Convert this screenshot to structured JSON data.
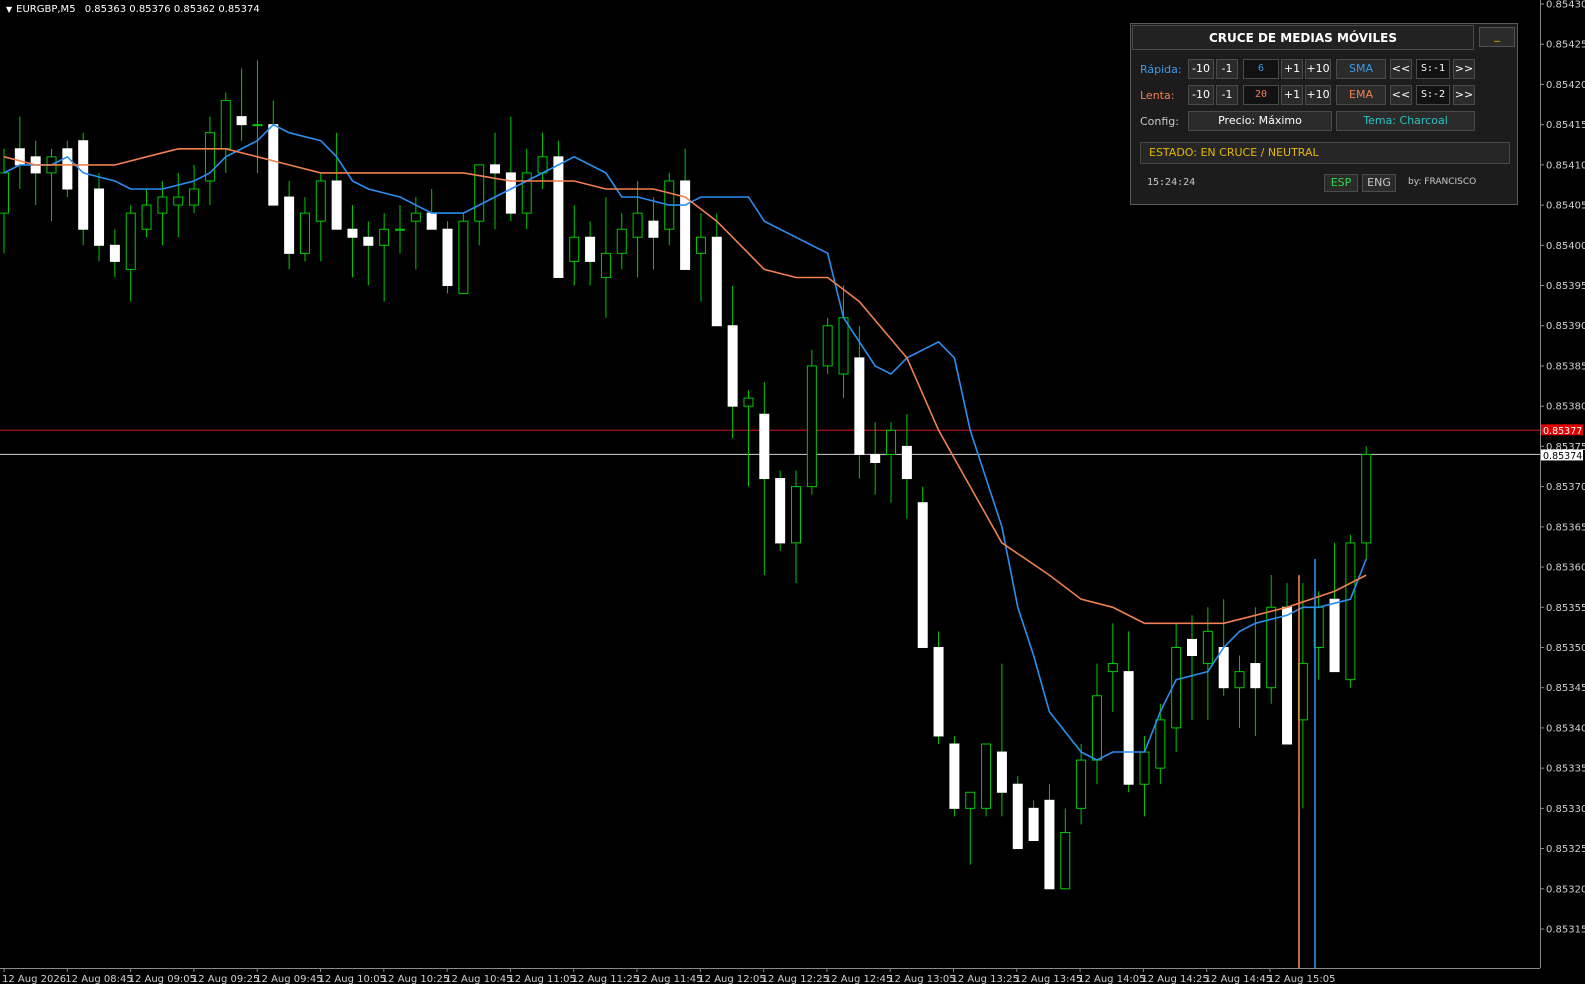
{
  "chart_header": {
    "symbol": "EURGBP,M5",
    "ohlc": "0.85363 0.85376 0.85362 0.85374"
  },
  "colors": {
    "bull_wick": "#00c800",
    "bear_body": "#ffffff",
    "fast_ma": "#2b8ff0",
    "slow_ma": "#f08050",
    "bid_line": "#cfcfcf",
    "ask_line": "#d21a1a",
    "ask_tag": "#e00000"
  },
  "price_axis": {
    "labels": [
      "0.85430",
      "0.85425",
      "0.85420",
      "0.85415",
      "0.85410",
      "0.85405",
      "0.85400",
      "0.85395",
      "0.85390",
      "0.85385",
      "0.85380",
      "0.85375",
      "0.85370",
      "0.85365",
      "0.85360",
      "0.85355",
      "0.85350",
      "0.85345",
      "0.85340",
      "0.85335",
      "0.85330",
      "0.85325",
      "0.85320",
      "0.85315"
    ],
    "ask_tag": "0.85377",
    "bid_tag": "0.85374"
  },
  "time_axis": {
    "labels": [
      "12 Aug 2026",
      "12 Aug 08:45",
      "12 Aug 09:05",
      "12 Aug 09:25",
      "12 Aug 09:45",
      "12 Aug 10:05",
      "12 Aug 10:25",
      "12 Aug 10:45",
      "12 Aug 11:05",
      "12 Aug 11:25",
      "12 Aug 11:45",
      "12 Aug 12:05",
      "12 Aug 12:25",
      "12 Aug 12:45",
      "12 Aug 13:05",
      "12 Aug 13:25",
      "12 Aug 13:45",
      "12 Aug 14:05",
      "12 Aug 14:25",
      "12 Aug 14:45",
      "12 Aug 15:05"
    ]
  },
  "panel": {
    "title": "CRUCE DE MEDIAS MÓVILES",
    "minimize": "_",
    "fast": {
      "label": "Rápida:",
      "m10": "-10",
      "m1": "-1",
      "value": "6",
      "p1": "+1",
      "p10": "+10",
      "type": "SMA",
      "prev": "<<",
      "shift": "S:-1",
      "next": ">>"
    },
    "slow": {
      "label": "Lenta:",
      "m10": "-10",
      "m1": "-1",
      "value": "20",
      "p1": "+1",
      "p10": "+10",
      "type": "EMA",
      "prev": "<<",
      "shift": "S:-2",
      "next": ">>"
    },
    "config": {
      "label": "Config:",
      "price": "Precio: Máximo",
      "theme": "Tema: Charcoal"
    },
    "status": "ESTADO: EN CRUCE / NEUTRAL",
    "clock": "15:24:24",
    "lang_esp": "ESP",
    "lang_eng": "ENG",
    "author": "by: FRANCISCO"
  },
  "chart_data": {
    "type": "candlestick",
    "symbol": "EURGBP",
    "timeframe": "M5",
    "ylim": [
      0.8531,
      0.8543
    ],
    "candles": [
      [
        0.85404,
        0.85412,
        0.85399,
        0.85409
      ],
      [
        0.85412,
        0.85416,
        0.85407,
        0.8541
      ],
      [
        0.85411,
        0.85413,
        0.85405,
        0.85409
      ],
      [
        0.85409,
        0.85412,
        0.85403,
        0.85411
      ],
      [
        0.85412,
        0.85413,
        0.85406,
        0.85407
      ],
      [
        0.85413,
        0.85414,
        0.854,
        0.85402
      ],
      [
        0.85407,
        0.85409,
        0.85398,
        0.854
      ],
      [
        0.854,
        0.85402,
        0.85396,
        0.85398
      ],
      [
        0.85397,
        0.85405,
        0.85393,
        0.85404
      ],
      [
        0.85402,
        0.85407,
        0.85401,
        0.85405
      ],
      [
        0.85404,
        0.85408,
        0.854,
        0.85406
      ],
      [
        0.85405,
        0.85409,
        0.85401,
        0.85406
      ],
      [
        0.85405,
        0.8541,
        0.85404,
        0.85407
      ],
      [
        0.85408,
        0.85416,
        0.85405,
        0.85414
      ],
      [
        0.85412,
        0.85419,
        0.85409,
        0.85418
      ],
      [
        0.85416,
        0.85422,
        0.85413,
        0.85415
      ],
      [
        0.85415,
        0.85423,
        0.85409,
        0.85415
      ],
      [
        0.85415,
        0.85418,
        0.85407,
        0.85405
      ],
      [
        0.85406,
        0.85408,
        0.85397,
        0.85399
      ],
      [
        0.85399,
        0.85406,
        0.85398,
        0.85404
      ],
      [
        0.85403,
        0.85409,
        0.85398,
        0.85408
      ],
      [
        0.85408,
        0.85414,
        0.85402,
        0.85402
      ],
      [
        0.85402,
        0.85405,
        0.85396,
        0.85401
      ],
      [
        0.85401,
        0.85403,
        0.85395,
        0.854
      ],
      [
        0.854,
        0.85404,
        0.85393,
        0.85402
      ],
      [
        0.85402,
        0.85405,
        0.85399,
        0.85402
      ],
      [
        0.85403,
        0.85406,
        0.85397,
        0.85404
      ],
      [
        0.85404,
        0.85407,
        0.85403,
        0.85402
      ],
      [
        0.85402,
        0.85403,
        0.85394,
        0.85395
      ],
      [
        0.85394,
        0.85404,
        0.85394,
        0.85403
      ],
      [
        0.85403,
        0.85409,
        0.854,
        0.8541
      ],
      [
        0.8541,
        0.85414,
        0.85402,
        0.85409
      ],
      [
        0.85409,
        0.85416,
        0.85403,
        0.85404
      ],
      [
        0.85404,
        0.85412,
        0.85402,
        0.85409
      ],
      [
        0.85409,
        0.85414,
        0.85407,
        0.85411
      ],
      [
        0.85411,
        0.85413,
        0.85399,
        0.85396
      ],
      [
        0.85398,
        0.85405,
        0.85395,
        0.85401
      ],
      [
        0.85401,
        0.85403,
        0.85395,
        0.85398
      ],
      [
        0.85396,
        0.85406,
        0.85391,
        0.85399
      ],
      [
        0.85399,
        0.85404,
        0.85397,
        0.85402
      ],
      [
        0.85401,
        0.85408,
        0.85396,
        0.85404
      ],
      [
        0.85403,
        0.85406,
        0.85397,
        0.85401
      ],
      [
        0.85402,
        0.85409,
        0.854,
        0.85408
      ],
      [
        0.85408,
        0.85412,
        0.854,
        0.85397
      ],
      [
        0.85399,
        0.85404,
        0.85393,
        0.85401
      ],
      [
        0.85401,
        0.85404,
        0.8539,
        0.8539
      ],
      [
        0.8539,
        0.85395,
        0.85376,
        0.8538
      ],
      [
        0.8538,
        0.85382,
        0.8537,
        0.85381
      ],
      [
        0.85379,
        0.85383,
        0.85359,
        0.85371
      ],
      [
        0.85371,
        0.85372,
        0.85362,
        0.85363
      ],
      [
        0.85363,
        0.85372,
        0.85358,
        0.8537
      ],
      [
        0.8537,
        0.85387,
        0.85369,
        0.85385
      ],
      [
        0.85385,
        0.85391,
        0.85384,
        0.8539
      ],
      [
        0.85384,
        0.85395,
        0.85381,
        0.85391
      ],
      [
        0.85386,
        0.8539,
        0.85371,
        0.85374
      ],
      [
        0.85374,
        0.85378,
        0.85369,
        0.85373
      ],
      [
        0.85374,
        0.85378,
        0.85368,
        0.85377
      ],
      [
        0.85375,
        0.85379,
        0.85366,
        0.85371
      ],
      [
        0.85368,
        0.8537,
        0.8535,
        0.8535
      ],
      [
        0.8535,
        0.85352,
        0.85338,
        0.85339
      ],
      [
        0.85338,
        0.85339,
        0.85329,
        0.8533
      ],
      [
        0.8533,
        0.85332,
        0.85323,
        0.85332
      ],
      [
        0.8533,
        0.85338,
        0.85329,
        0.85338
      ],
      [
        0.85337,
        0.85348,
        0.85329,
        0.85332
      ],
      [
        0.85333,
        0.85334,
        0.85325,
        0.85325
      ],
      [
        0.8533,
        0.85331,
        0.85326,
        0.85326
      ],
      [
        0.85331,
        0.85333,
        0.8532,
        0.8532
      ],
      [
        0.8532,
        0.8533,
        0.8532,
        0.85327
      ],
      [
        0.8533,
        0.85338,
        0.85328,
        0.85336
      ],
      [
        0.85336,
        0.85348,
        0.85333,
        0.85344
      ],
      [
        0.85347,
        0.85353,
        0.85342,
        0.85348
      ],
      [
        0.85347,
        0.85352,
        0.85332,
        0.85333
      ],
      [
        0.85333,
        0.85339,
        0.85329,
        0.85337
      ],
      [
        0.85335,
        0.85343,
        0.85333,
        0.85341
      ],
      [
        0.8534,
        0.85353,
        0.85337,
        0.8535
      ],
      [
        0.85351,
        0.85354,
        0.85341,
        0.85349
      ],
      [
        0.85348,
        0.85355,
        0.85341,
        0.85352
      ],
      [
        0.8535,
        0.85356,
        0.85344,
        0.85345
      ],
      [
        0.85345,
        0.85349,
        0.8534,
        0.85347
      ],
      [
        0.85348,
        0.85355,
        0.85339,
        0.85345
      ],
      [
        0.85345,
        0.85359,
        0.85343,
        0.85355
      ],
      [
        0.85355,
        0.85358,
        0.85345,
        0.85338
      ],
      [
        0.85341,
        0.85358,
        0.8533,
        0.85348
      ],
      [
        0.8535,
        0.85357,
        0.85346,
        0.85355
      ],
      [
        0.85356,
        0.85363,
        0.85348,
        0.85347
      ],
      [
        0.85346,
        0.85364,
        0.85345,
        0.85363
      ],
      [
        0.85363,
        0.85375,
        0.85361,
        0.85374
      ]
    ],
    "fast_ma": [
      0.85409,
      0.8541,
      0.8541,
      0.85411,
      0.85409,
      0.85408,
      0.85407,
      0.85407,
      0.85407,
      0.85408,
      0.85409,
      0.85411,
      0.85413,
      0.85415,
      0.85414,
      0.85413,
      0.85411,
      0.85408,
      0.85407,
      0.85406,
      0.85405,
      0.85404,
      0.85404,
      0.85405,
      0.85406,
      0.85408,
      0.85409,
      0.8541,
      0.85411,
      0.85409,
      0.85406,
      0.85406,
      0.85405,
      0.85405,
      0.85406,
      0.85406,
      0.85406,
      0.85403,
      0.85401,
      0.854,
      0.85399,
      0.85391,
      0.85385,
      0.85384,
      0.85386,
      0.85388,
      0.85386,
      0.85377,
      0.85365,
      0.85355,
      0.85349,
      0.85342,
      0.85337,
      0.85336,
      0.85337,
      0.85337,
      0.85342,
      0.85346,
      0.85347,
      0.8535,
      0.85352,
      0.85353,
      0.85354,
      0.85355,
      0.85355,
      0.85356,
      0.85361
    ],
    "slow_ma": [
      0.85411,
      0.8541,
      0.8541,
      0.8541,
      0.85411,
      0.85412,
      0.85412,
      0.85411,
      0.8541,
      0.85409,
      0.85409,
      0.85409,
      0.85409,
      0.85409,
      0.85408,
      0.85408,
      0.85408,
      0.85407,
      0.85407,
      0.85406,
      0.85403,
      0.85397,
      0.85396,
      0.85396,
      0.85393,
      0.85386,
      0.85377,
      0.8537,
      0.85363,
      0.85359,
      0.85356,
      0.85355,
      0.85353,
      0.85353,
      0.85353,
      0.85354,
      0.85355,
      0.85357,
      0.85359
    ]
  }
}
